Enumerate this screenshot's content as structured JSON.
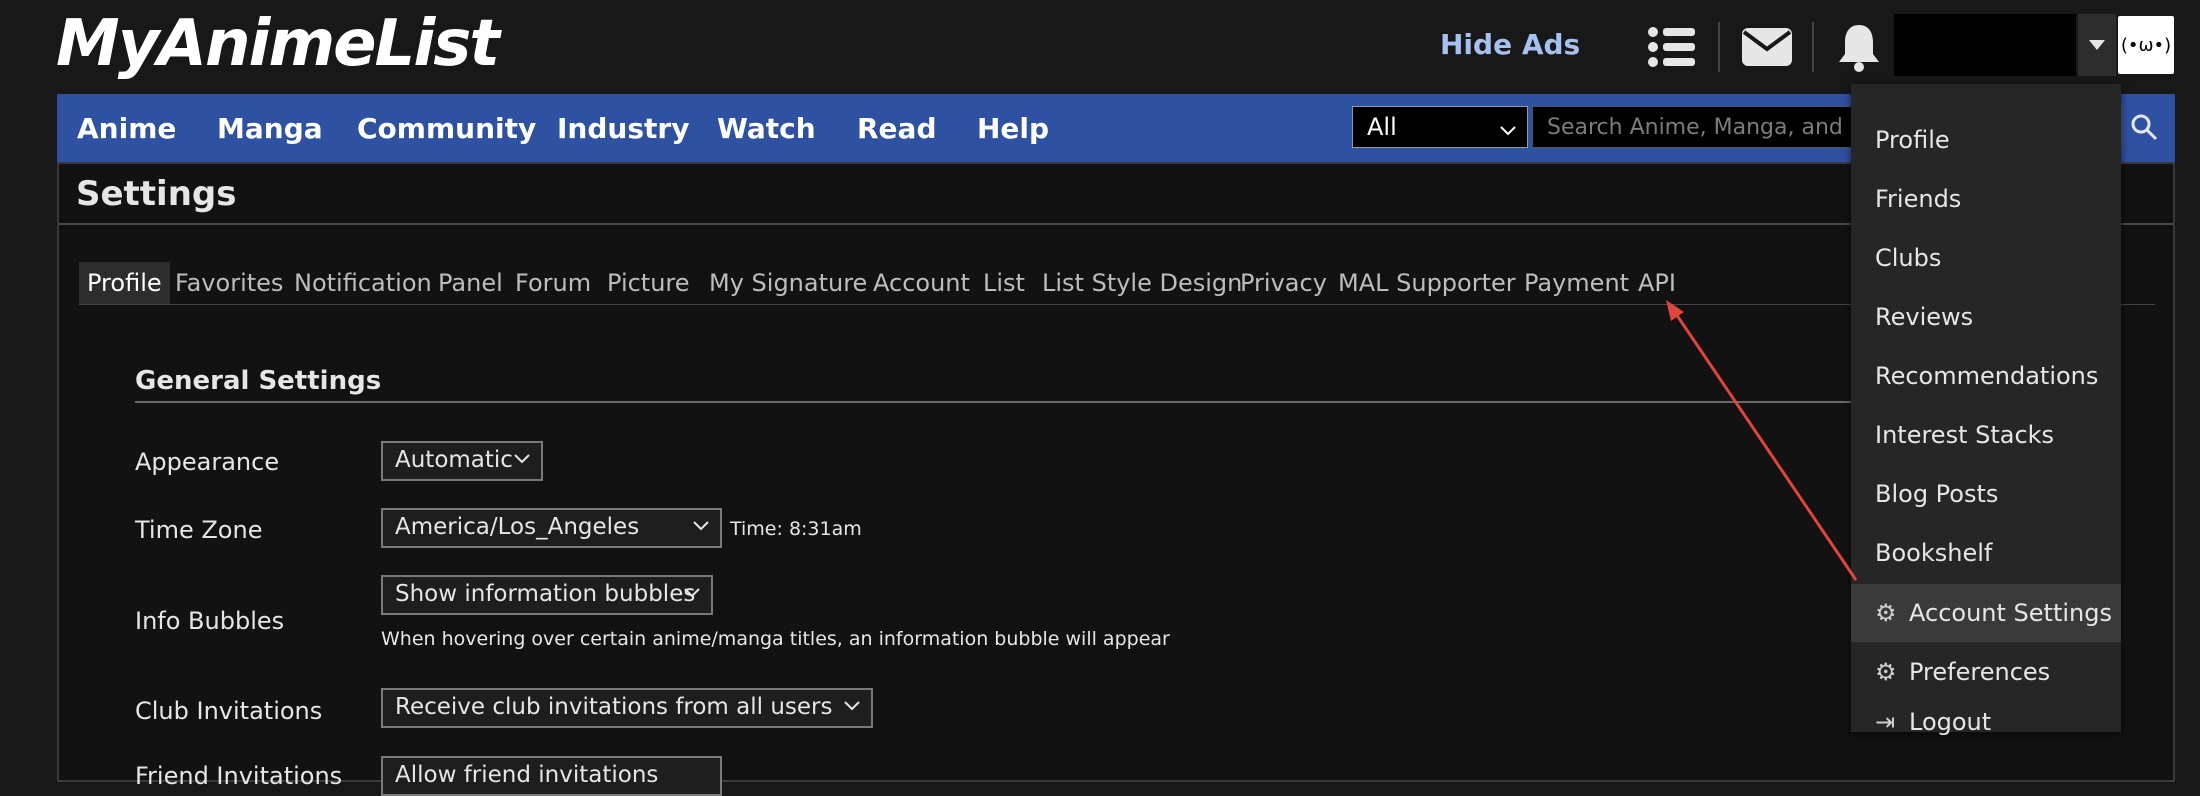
{
  "header": {
    "logo_text": "MyAnimeList",
    "hide_ads": "Hide Ads",
    "avatar_text": "(•ω•)"
  },
  "nav": {
    "items": [
      "Anime",
      "Manga",
      "Community",
      "Industry",
      "Watch",
      "Read",
      "Help"
    ],
    "search_select": "All",
    "search_placeholder": "Search Anime, Manga, and more..."
  },
  "page": {
    "title": "Settings",
    "tabs": [
      "Profile",
      "Favorites",
      "Notification",
      "Panel",
      "Forum",
      "Picture",
      "My Signature",
      "Account",
      "List",
      "List Style Design",
      "Privacy",
      "MAL Supporter",
      "Payment",
      "API"
    ],
    "active_tab": "Profile"
  },
  "general": {
    "title": "General Settings",
    "rows": [
      {
        "label": "Appearance",
        "value": "Automatic"
      },
      {
        "label": "Time Zone",
        "value": "America/Los_Angeles",
        "extra": "Time: 8:31am"
      },
      {
        "label": "Info Bubbles",
        "value": "Show information bubbles",
        "hint": "When hovering over certain anime/manga titles, an information bubble will appear"
      },
      {
        "label": "Club Invitations",
        "value": "Receive club invitations from all users"
      },
      {
        "label": "Friend Invitations",
        "value": "Allow friend invitations"
      }
    ]
  },
  "user_menu": {
    "items": [
      "Profile",
      "Friends",
      "Clubs",
      "Reviews",
      "Recommendations",
      "Interest Stacks",
      "Blog Posts",
      "Bookshelf",
      "Account Settings",
      "Preferences",
      "Logout"
    ]
  },
  "colors": {
    "nav_blue": "#2e51a2",
    "hide_ads": "#a6c1f0",
    "annotation_arrow": "#e0443a"
  }
}
